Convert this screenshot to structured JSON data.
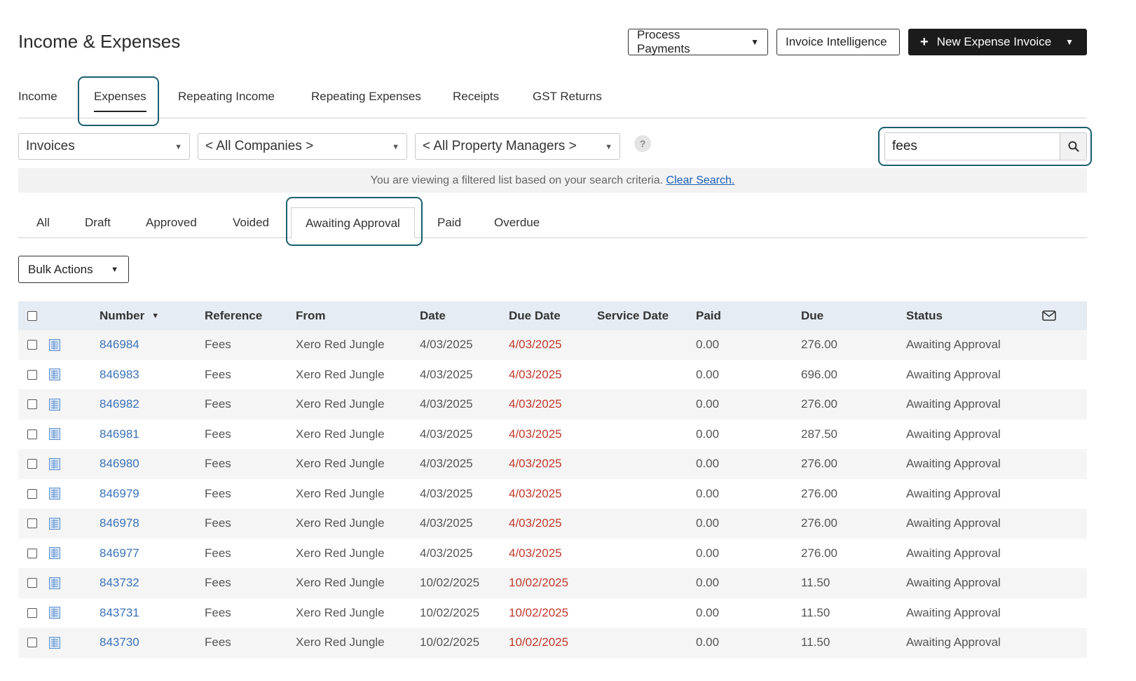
{
  "page": {
    "title": "Income & Expenses"
  },
  "header_buttons": {
    "process_payments": "Process Payments",
    "invoice_intelligence": "Invoice Intelligence",
    "new_expense_invoice": "New Expense Invoice"
  },
  "main_tabs": [
    "Income",
    "Expenses",
    "Repeating Income",
    "Repeating Expenses",
    "Receipts",
    "GST Returns"
  ],
  "active_main_tab": "Expenses",
  "filters": {
    "type": "Invoices",
    "companies": "< All Companies >",
    "managers": "< All Property Managers >",
    "help": "?"
  },
  "search": {
    "value": "fees"
  },
  "notice": {
    "text": "You are viewing a filtered list based on your search criteria.",
    "link": "Clear Search."
  },
  "status_tabs": [
    "All",
    "Draft",
    "Approved",
    "Voided",
    "Awaiting Approval",
    "Paid",
    "Overdue"
  ],
  "active_status_tab": "Awaiting Approval",
  "bulk_actions": "Bulk Actions",
  "table": {
    "columns": {
      "number": "Number",
      "reference": "Reference",
      "from": "From",
      "date": "Date",
      "due_date": "Due Date",
      "service_date": "Service Date",
      "paid": "Paid",
      "due": "Due",
      "status": "Status"
    },
    "rows": [
      {
        "number": "846984",
        "reference": "Fees",
        "from": "Xero Red Jungle",
        "date": "4/03/2025",
        "due_date": "4/03/2025",
        "service_date": "",
        "paid": "0.00",
        "due": "276.00",
        "status": "Awaiting Approval"
      },
      {
        "number": "846983",
        "reference": "Fees",
        "from": "Xero Red Jungle",
        "date": "4/03/2025",
        "due_date": "4/03/2025",
        "service_date": "",
        "paid": "0.00",
        "due": "696.00",
        "status": "Awaiting Approval"
      },
      {
        "number": "846982",
        "reference": "Fees",
        "from": "Xero Red Jungle",
        "date": "4/03/2025",
        "due_date": "4/03/2025",
        "service_date": "",
        "paid": "0.00",
        "due": "276.00",
        "status": "Awaiting Approval"
      },
      {
        "number": "846981",
        "reference": "Fees",
        "from": "Xero Red Jungle",
        "date": "4/03/2025",
        "due_date": "4/03/2025",
        "service_date": "",
        "paid": "0.00",
        "due": "287.50",
        "status": "Awaiting Approval"
      },
      {
        "number": "846980",
        "reference": "Fees",
        "from": "Xero Red Jungle",
        "date": "4/03/2025",
        "due_date": "4/03/2025",
        "service_date": "",
        "paid": "0.00",
        "due": "276.00",
        "status": "Awaiting Approval"
      },
      {
        "number": "846979",
        "reference": "Fees",
        "from": "Xero Red Jungle",
        "date": "4/03/2025",
        "due_date": "4/03/2025",
        "service_date": "",
        "paid": "0.00",
        "due": "276.00",
        "status": "Awaiting Approval"
      },
      {
        "number": "846978",
        "reference": "Fees",
        "from": "Xero Red Jungle",
        "date": "4/03/2025",
        "due_date": "4/03/2025",
        "service_date": "",
        "paid": "0.00",
        "due": "276.00",
        "status": "Awaiting Approval"
      },
      {
        "number": "846977",
        "reference": "Fees",
        "from": "Xero Red Jungle",
        "date": "4/03/2025",
        "due_date": "4/03/2025",
        "service_date": "",
        "paid": "0.00",
        "due": "276.00",
        "status": "Awaiting Approval"
      },
      {
        "number": "843732",
        "reference": "Fees",
        "from": "Xero Red Jungle",
        "date": "10/02/2025",
        "due_date": "10/02/2025",
        "service_date": "",
        "paid": "0.00",
        "due": "11.50",
        "status": "Awaiting Approval"
      },
      {
        "number": "843731",
        "reference": "Fees",
        "from": "Xero Red Jungle",
        "date": "10/02/2025",
        "due_date": "10/02/2025",
        "service_date": "",
        "paid": "0.00",
        "due": "11.50",
        "status": "Awaiting Approval"
      },
      {
        "number": "843730",
        "reference": "Fees",
        "from": "Xero Red Jungle",
        "date": "10/02/2025",
        "due_date": "10/02/2025",
        "service_date": "",
        "paid": "0.00",
        "due": "11.50",
        "status": "Awaiting Approval"
      }
    ]
  },
  "colors": {
    "link": "#3a72b8",
    "overdue": "#c0392b",
    "highlight": "#1b5f6e",
    "header_bg": "#e6ecf3"
  }
}
